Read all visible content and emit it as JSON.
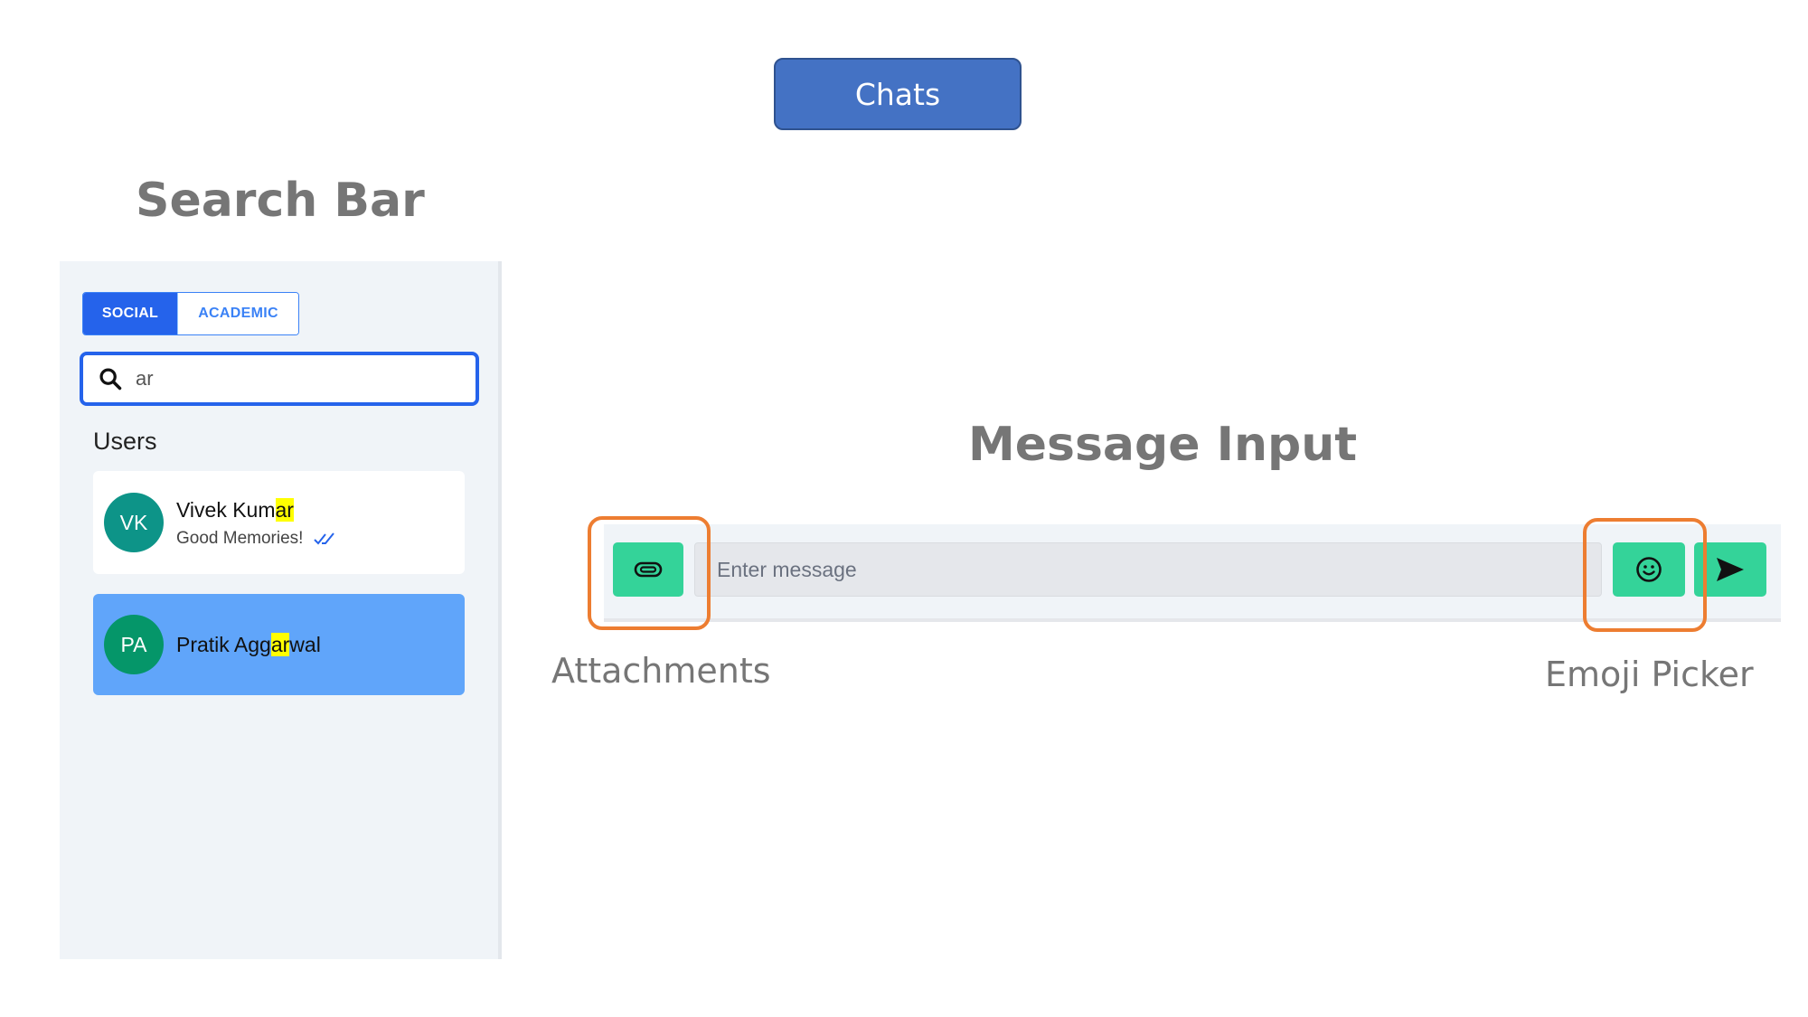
{
  "title": "Chats",
  "headings": {
    "search_bar": "Search Bar",
    "message_input": "Message Input"
  },
  "captions": {
    "attachments": "Attachments",
    "emoji_picker": "Emoji Picker"
  },
  "sidebar": {
    "tabs": [
      {
        "label": "SOCIAL",
        "active": true
      },
      {
        "label": "ACADEMIC",
        "active": false
      }
    ],
    "search": {
      "value": "ar",
      "icon": "search-icon"
    },
    "section_label": "Users",
    "users": [
      {
        "initials": "VK",
        "name_pre": "Vivek Kum",
        "name_match": "ar",
        "name_post": "",
        "last_message": "Good Memories!",
        "status_icon": "double-check-icon",
        "avatar_color": "#0d9488",
        "selected": false
      },
      {
        "initials": "PA",
        "name_pre": "Pratik Agg",
        "name_match": "ar",
        "name_post": "wal",
        "last_message": "",
        "avatar_color": "#059669",
        "selected": true
      }
    ]
  },
  "message_bar": {
    "placeholder": "Enter message",
    "attach_icon": "paperclip-icon",
    "emoji_icon": "smiley-icon",
    "send_icon": "send-icon"
  },
  "colors": {
    "accent": "#2563eb",
    "button_green": "#34d399",
    "highlight_orange": "#ed7d31",
    "title_box": "#4472c4",
    "selected_card": "#60a5fa"
  }
}
